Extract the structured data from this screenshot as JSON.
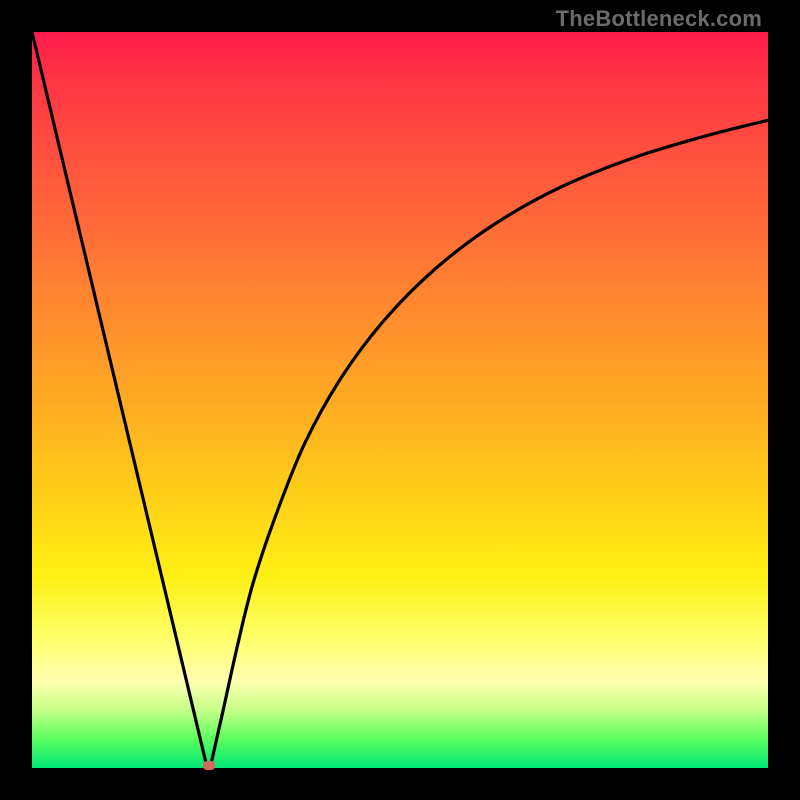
{
  "watermark": "TheBottleneck.com",
  "chart_data": {
    "type": "line",
    "title": "",
    "xlabel": "",
    "ylabel": "",
    "x_range": [
      0,
      1
    ],
    "y_range": [
      0,
      1
    ],
    "series": [
      {
        "name": "left-branch",
        "x": [
          0.0,
          0.05,
          0.1,
          0.15,
          0.2,
          0.238
        ],
        "y": [
          1.0,
          0.79,
          0.58,
          0.37,
          0.16,
          0.0
        ]
      },
      {
        "name": "right-branch",
        "x": [
          0.242,
          0.26,
          0.28,
          0.3,
          0.33,
          0.37,
          0.42,
          0.48,
          0.55,
          0.63,
          0.72,
          0.82,
          0.92,
          1.0
        ],
        "y": [
          0.0,
          0.08,
          0.17,
          0.25,
          0.34,
          0.44,
          0.53,
          0.61,
          0.68,
          0.74,
          0.79,
          0.83,
          0.86,
          0.88
        ]
      }
    ],
    "marker": {
      "name": "minimum-dot",
      "x": 0.24,
      "y": 0.0,
      "color": "#d66a5a"
    },
    "background_gradient": {
      "top": "#ff1a4d",
      "mid": "#ffd817",
      "bottom": "#00e676"
    }
  }
}
